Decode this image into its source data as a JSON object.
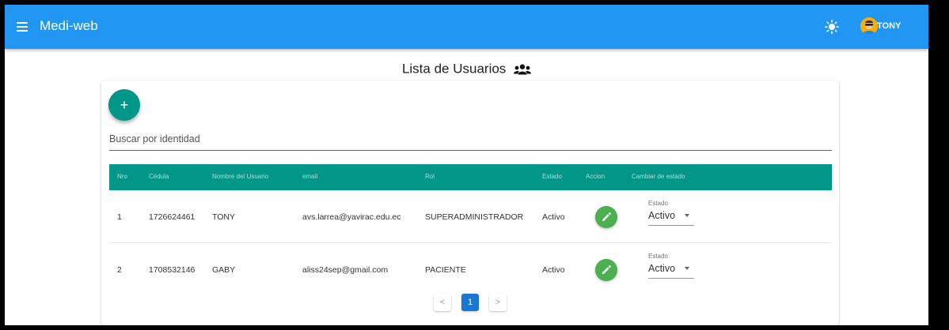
{
  "app": {
    "title": "Medi-web",
    "user": "TONY"
  },
  "page": {
    "title": "Lista de Usuarios"
  },
  "add_button": {
    "label": "+"
  },
  "search": {
    "placeholder": "Buscar por identidad",
    "value": ""
  },
  "table": {
    "headers": [
      "Nro",
      "Cédula",
      "Nombre del Usuario",
      "email",
      "Rol",
      "Estado",
      "Accion",
      "Cambiar de estado"
    ],
    "rows": [
      {
        "nro": "1",
        "cedula": "1726624461",
        "nombre": "TONY",
        "email": "avs.larrea@yavirac.edu.ec",
        "rol": "SUPERADMINISTRADOR",
        "estado": "Activo",
        "select_label": "Estado",
        "select_value": "Activo"
      },
      {
        "nro": "2",
        "cedula": "1708532146",
        "nombre": "GABY",
        "email": "aliss24sep@gmail.com",
        "rol": "PACIENTE",
        "estado": "Activo",
        "select_label": "Estado",
        "select_value": "Activo"
      }
    ]
  },
  "pagination": {
    "prev": "<",
    "current": "1",
    "next": ">"
  },
  "icons": {
    "menu": "menu-icon",
    "theme": "sun-icon",
    "avatar": "avatar-icon",
    "users": "users-icon",
    "edit": "pencil-icon",
    "dropdown": "chevron-down-icon"
  },
  "colors": {
    "appbar": "#2196f3",
    "table_header": "#009688",
    "fab": "#009688",
    "edit_button": "#4caf50",
    "active_page": "#1976d2"
  }
}
